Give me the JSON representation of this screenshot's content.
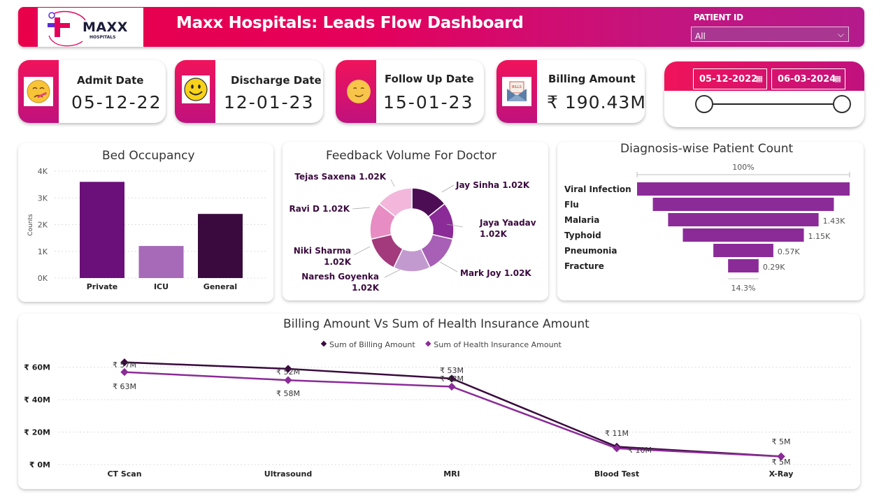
{
  "header": {
    "logo_text": "MAXX",
    "logo_sub": "HOSPITALS",
    "title": "Maxx Hospitals: Leads Flow Dashboard",
    "patient_id_label": "PATIENT ID",
    "patient_id_value": "All"
  },
  "kpis": [
    {
      "label": "Admit Date",
      "value": "05-12-22",
      "icon": "sick-face-icon"
    },
    {
      "label": "Discharge Date",
      "value": "12-01-23",
      "icon": "smiley-face-icon"
    },
    {
      "label": "Follow Up Date",
      "value": "15-01-23",
      "icon": "slight-smile-icon"
    },
    {
      "label": "Billing Amount",
      "value": "₹ 190.43M",
      "icon": "bills-envelope-icon"
    }
  ],
  "date_slicer": {
    "start": "05-12-2022",
    "end": "06-03-2024"
  },
  "colors": {
    "accent_pink": "#e8004a",
    "accent_purple": "#b41a8c",
    "dark_purple": "#3a0a3e",
    "mid_purple": "#6b0f7a",
    "light_purple": "#a66ab8",
    "funnel_purple": "#8b2b98"
  },
  "chart_data": [
    {
      "type": "bar",
      "title": "Bed Occupancy",
      "ylabel": "Counts",
      "categories": [
        "Private",
        "ICU",
        "General"
      ],
      "values": [
        3600,
        1200,
        2400
      ],
      "bar_colors": [
        "#6b0f7a",
        "#a66ab8",
        "#3a0a3e"
      ],
      "ylim": [
        0,
        4000
      ],
      "yticks": [
        "0K",
        "1K",
        "2K",
        "3K",
        "4K"
      ],
      "ytick_values": [
        0,
        1000,
        2000,
        3000,
        4000
      ],
      "grid": true
    },
    {
      "type": "pie",
      "title": "Feedback Volume For Doctor",
      "slices": [
        {
          "name": "Jay Sinha",
          "label": "Jay Sinha 1.02K",
          "value": 1020,
          "color": "#4d0d55"
        },
        {
          "name": "Jaya Yaadav",
          "label1": "Jaya Yaadav",
          "label2": "1.02K",
          "value": 1020,
          "color": "#8b2b98"
        },
        {
          "name": "Mark Joy",
          "label": "Mark Joy 1.02K",
          "value": 1020,
          "color": "#a760b6"
        },
        {
          "name": "Naresh Goyenka",
          "label1": "Naresh Goyenka",
          "label2": "1.02K",
          "value": 1020,
          "color": "#c39ad0"
        },
        {
          "name": "Niki Sharma",
          "label1": "Niki Sharma",
          "label2": "1.02K",
          "value": 1020,
          "color": "#a23a7b"
        },
        {
          "name": "Ravi D",
          "label": "Ravi D 1.02K",
          "value": 1020,
          "color": "#e78dc3"
        },
        {
          "name": "Tejas Saxena",
          "label": "Tejas Saxena 1.02K",
          "value": 1020,
          "color": "#f2b7db"
        }
      ]
    },
    {
      "type": "bar",
      "orientation": "funnel",
      "title": "Diagnosis-wise Patient Count",
      "top_percent_label": "100%",
      "bottom_percent_label": "14.3%",
      "categories": [
        "Viral Infection",
        "Flu",
        "Malaria",
        "Typhoid",
        "Pneumonia",
        "Fracture"
      ],
      "values": [
        2020,
        1720,
        1430,
        1150,
        570,
        290
      ],
      "value_labels": [
        "",
        "",
        "1.43K",
        "1.15K",
        "0.57K",
        "0.29K"
      ],
      "bar_color": "#8b2b98"
    },
    {
      "type": "line",
      "title": "Billing Amount Vs Sum of Health Insurance Amount",
      "categories": [
        "CT Scan",
        "Ultrasound",
        "MRI",
        "Blood Test",
        "X-Ray"
      ],
      "yticks": [
        "₹ 0M",
        "₹ 20M",
        "₹ 40M",
        "₹ 60M"
      ],
      "ytick_values": [
        0,
        20,
        40,
        60
      ],
      "ylim": [
        0,
        65
      ],
      "series": [
        {
          "name": "Sum of Billing Amount",
          "color": "#3a0a3e",
          "values": [
            63,
            59,
            53,
            11,
            5
          ],
          "labels": [
            "₹ 63M",
            "₹ 52M",
            "₹ 53M",
            "₹ 11M",
            "₹ 5M"
          ]
        },
        {
          "name": "Sum of Health Insurance Amount",
          "color": "#8b2b98",
          "values": [
            57,
            52,
            48,
            10,
            5
          ],
          "labels": [
            "₹ 57M",
            "₹ 58M",
            "₹ 48M",
            "₹ 10M",
            "₹ 5M"
          ]
        }
      ]
    }
  ]
}
